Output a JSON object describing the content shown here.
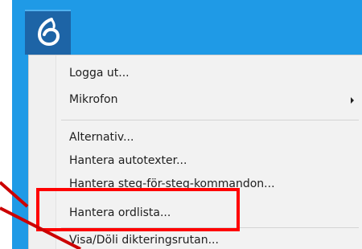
{
  "colors": {
    "taskbar_blue": "#1f9ae6",
    "logo_tile": "#1d64a6",
    "menu_background": "#f2f2f2",
    "annotation_red": "#ff0000"
  },
  "app_icon": "dragon-logo-icon",
  "menu": {
    "items": [
      {
        "label": "Logga ut...",
        "has_submenu": false
      },
      {
        "label": "Mikrofon",
        "has_submenu": true
      },
      {
        "label": "Alternativ...",
        "has_submenu": false
      },
      {
        "label": "Hantera autotexter...",
        "has_submenu": false
      },
      {
        "label": "Hantera steg-för-steg-kommandon...",
        "has_submenu": false
      },
      {
        "label": "Hantera ordlista...",
        "has_submenu": false,
        "highlighted_by_annotation": true
      },
      {
        "label": "Visa/Döli dikteringsrutan...",
        "has_submenu": false
      }
    ]
  }
}
